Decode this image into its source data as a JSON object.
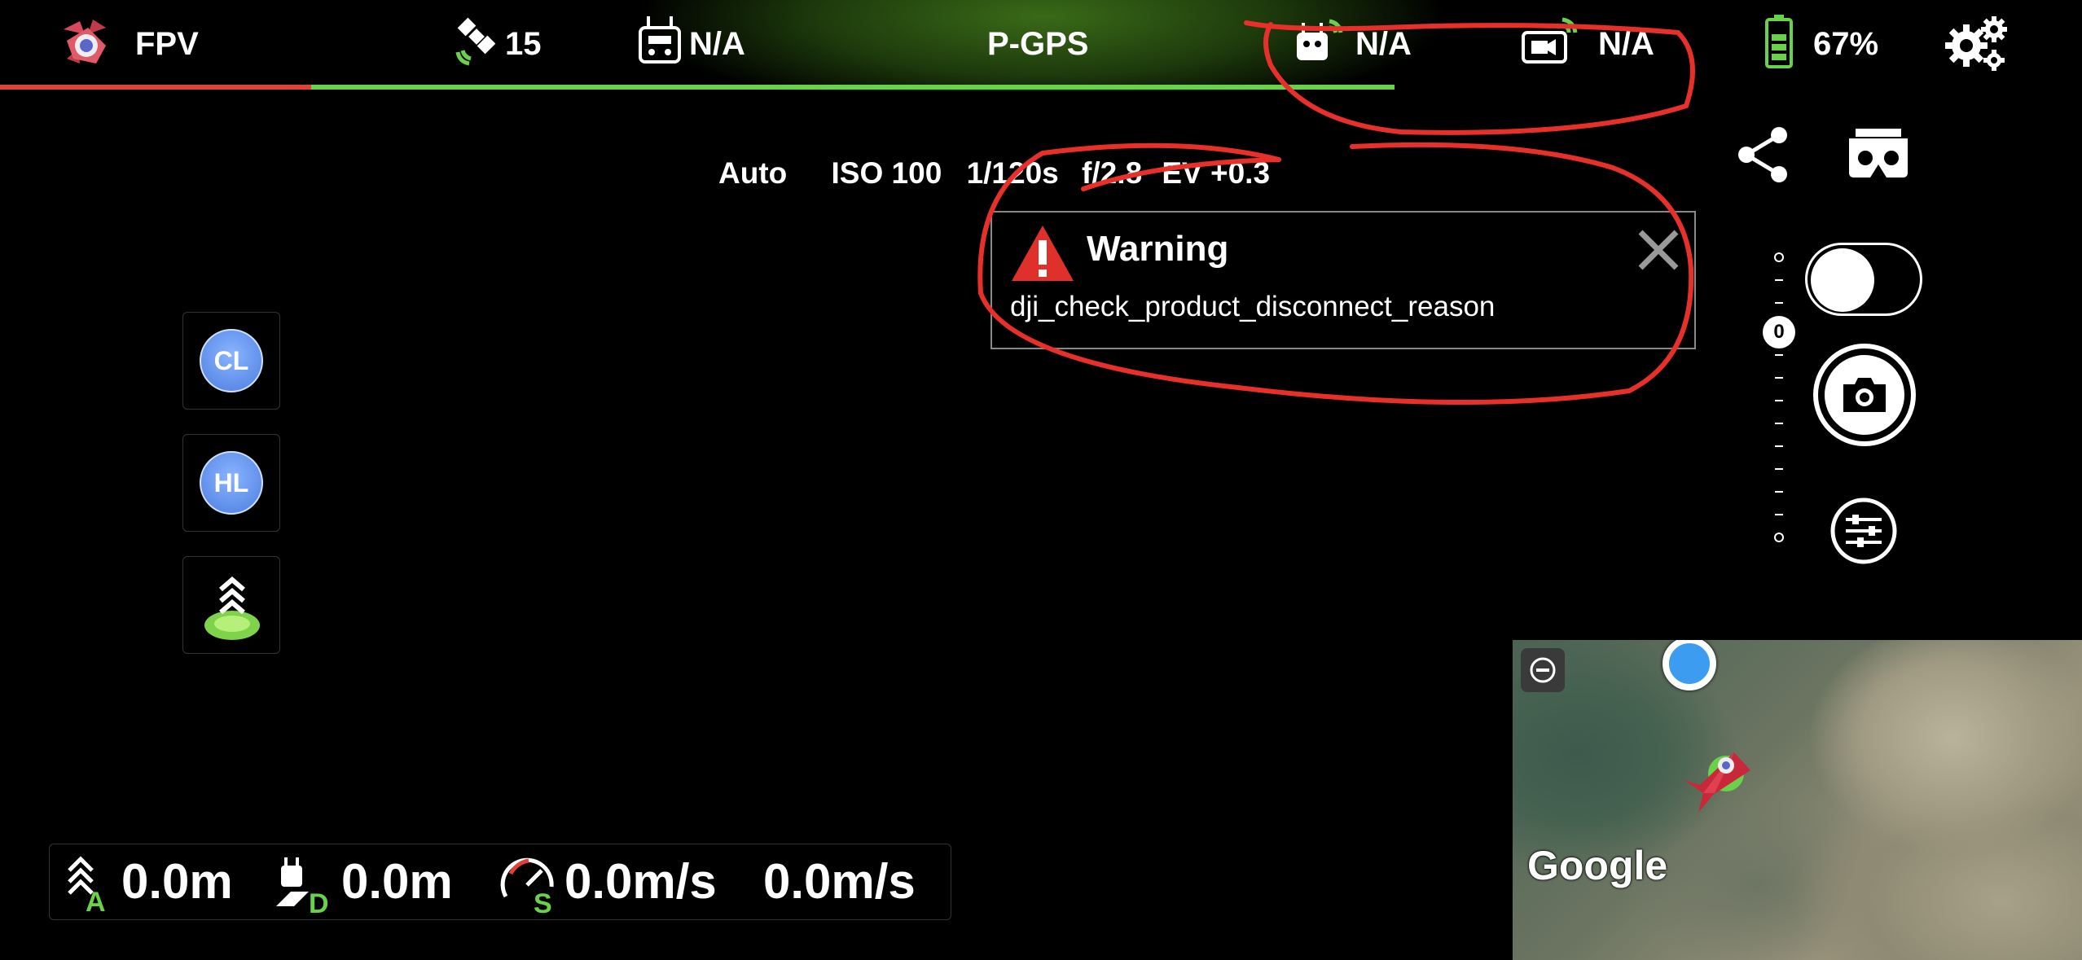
{
  "topbar": {
    "mode_label": "FPV",
    "satellites": "15",
    "remote_signal": "N/A",
    "flight_mode": "P-GPS",
    "aircraft_signal": "N/A",
    "video_signal": "N/A",
    "battery": "67%"
  },
  "exposure": {
    "mode": "Auto",
    "iso": "ISO 100",
    "shutter": "1/120s",
    "aperture": "f/2.8",
    "ev": "EV +0.3"
  },
  "warning": {
    "title": "Warning",
    "message": "dji_check_product_disconnect_reason"
  },
  "left_buttons": {
    "cl_label": "CL",
    "hl_label": "HL"
  },
  "exposure_slider": {
    "value_label": "0"
  },
  "telemetry": {
    "altitude": "0.0m",
    "distance": "0.0m",
    "horizontal_speed": "0.0m/s",
    "vertical_speed": "0.0m/s"
  },
  "map": {
    "attribution": "Google"
  },
  "colors": {
    "accent_green": "#6ad24a",
    "alert_red": "#e0423a",
    "badge_blue": "#4c7ee0"
  }
}
